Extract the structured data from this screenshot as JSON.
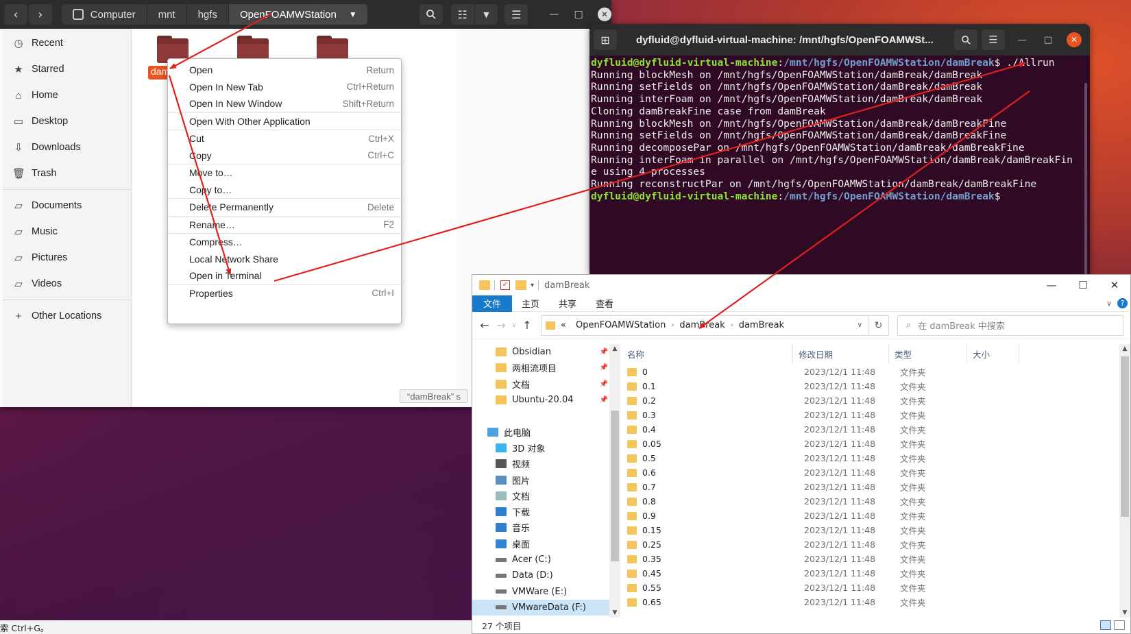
{
  "nautilus": {
    "path": [
      "Computer",
      "mnt",
      "hgfs",
      "OpenFOAMWStation"
    ],
    "sidebar": [
      {
        "label": "Recent",
        "icon": "clock-icon"
      },
      {
        "label": "Starred",
        "icon": "star-icon"
      },
      {
        "label": "Home",
        "icon": "home-icon"
      },
      {
        "label": "Desktop",
        "icon": "desktop-icon"
      },
      {
        "label": "Downloads",
        "icon": "download-icon"
      },
      {
        "label": "Trash",
        "icon": "trash-icon"
      },
      {
        "label": "Documents",
        "icon": "folder-icon"
      },
      {
        "label": "Music",
        "icon": "folder-icon"
      },
      {
        "label": "Pictures",
        "icon": "folder-icon"
      },
      {
        "label": "Videos",
        "icon": "folder-icon"
      },
      {
        "label": "Other Locations",
        "icon": "plus-icon"
      }
    ],
    "selected_folder_label": "dam",
    "status_text": "“damBreak” s",
    "accent_color": "#e95420"
  },
  "context_menu": {
    "items": [
      {
        "label": "Open",
        "shortcut": "Return"
      },
      {
        "label": "Open In New Tab",
        "shortcut": "Ctrl+Return"
      },
      {
        "label": "Open In New Window",
        "shortcut": "Shift+Return"
      },
      {
        "label": "Open With Other Application",
        "shortcut": ""
      },
      {
        "label": "Cut",
        "shortcut": "Ctrl+X"
      },
      {
        "label": "Copy",
        "shortcut": "Ctrl+C"
      },
      {
        "label": "Move to…",
        "shortcut": ""
      },
      {
        "label": "Copy to…",
        "shortcut": ""
      },
      {
        "label": "Delete Permanently",
        "shortcut": "Delete"
      },
      {
        "label": "Rename…",
        "shortcut": "F2"
      },
      {
        "label": "Compress…",
        "shortcut": ""
      },
      {
        "label": "Local Network Share",
        "shortcut": ""
      },
      {
        "label": "Open in Terminal",
        "shortcut": ""
      },
      {
        "label": "Properties",
        "shortcut": "Ctrl+I"
      }
    ]
  },
  "terminal": {
    "title": "dyfluid@dyfluid-virtual-machine: /mnt/hgfs/OpenFOAMWSt...",
    "prompt_user": "dyfluid@dyfluid-virtual-machine",
    "prompt_path": "/mnt/hgfs/OpenFOAMWStation/damBreak",
    "command": "./Allrun",
    "output": [
      "Running blockMesh on /mnt/hgfs/OpenFOAMWStation/damBreak/damBreak",
      "Running setFields on /mnt/hgfs/OpenFOAMWStation/damBreak/damBreak",
      "Running interFoam on /mnt/hgfs/OpenFOAMWStation/damBreak/damBreak",
      "Cloning damBreakFine case from damBreak",
      "Running blockMesh on /mnt/hgfs/OpenFOAMWStation/damBreak/damBreakFine",
      "Running setFields on /mnt/hgfs/OpenFOAMWStation/damBreak/damBreakFine",
      "Running decomposePar on /mnt/hgfs/OpenFOAMWStation/damBreak/damBreakFine",
      "Running interFoam in parallel on /mnt/hgfs/OpenFOAMWStation/damBreak/damBreakFin",
      "e using 4 processes",
      "Running reconstructPar on /mnt/hgfs/OpenFOAMWStation/damBreak/damBreakFine"
    ]
  },
  "explorer": {
    "title": "damBreak",
    "ribbon_tabs": [
      "文件",
      "主页",
      "共享",
      "查看"
    ],
    "address": {
      "prefix": "«",
      "segments": [
        "OpenFOAMWStation",
        "damBreak",
        "damBreak"
      ]
    },
    "search_placeholder": "在 damBreak 中搜索",
    "nav_items": [
      {
        "label": "Obsidian",
        "icon": "folder-icon",
        "pinned": true,
        "indent": 1
      },
      {
        "label": "两相流项目",
        "icon": "folder-icon",
        "pinned": true,
        "indent": 1
      },
      {
        "label": "文档",
        "icon": "folder-icon",
        "pinned": true,
        "indent": 1
      },
      {
        "label": "Ubuntu-20.04",
        "icon": "folder-icon",
        "pinned": true,
        "indent": 1
      },
      {
        "label": "",
        "icon": "",
        "pinned": false,
        "indent": 0
      },
      {
        "label": "此电脑",
        "icon": "computer-icon",
        "pinned": false,
        "indent": 0
      },
      {
        "label": "3D 对象",
        "icon": "cube-icon",
        "pinned": false,
        "indent": 1
      },
      {
        "label": "视频",
        "icon": "video-icon",
        "pinned": false,
        "indent": 1
      },
      {
        "label": "图片",
        "icon": "image-icon",
        "pinned": false,
        "indent": 1
      },
      {
        "label": "文档",
        "icon": "document-icon",
        "pinned": false,
        "indent": 1
      },
      {
        "label": "下载",
        "icon": "download-icon",
        "pinned": false,
        "indent": 1
      },
      {
        "label": "音乐",
        "icon": "music-icon",
        "pinned": false,
        "indent": 1
      },
      {
        "label": "桌面",
        "icon": "desktop-icon",
        "pinned": false,
        "indent": 1
      },
      {
        "label": "Acer (C:)",
        "icon": "drive-icon",
        "pinned": false,
        "indent": 1
      },
      {
        "label": "Data (D:)",
        "icon": "drive-icon",
        "pinned": false,
        "indent": 1
      },
      {
        "label": "VMWare (E:)",
        "icon": "drive-icon",
        "pinned": false,
        "indent": 1
      },
      {
        "label": "VMwareData (F:)",
        "icon": "drive-icon",
        "pinned": false,
        "indent": 1
      }
    ],
    "columns": [
      "名称",
      "修改日期",
      "类型",
      "大小"
    ],
    "files": [
      {
        "name": "0",
        "date": "2023/12/1 11:48",
        "type": "文件夹"
      },
      {
        "name": "0.1",
        "date": "2023/12/1 11:48",
        "type": "文件夹"
      },
      {
        "name": "0.2",
        "date": "2023/12/1 11:48",
        "type": "文件夹"
      },
      {
        "name": "0.3",
        "date": "2023/12/1 11:48",
        "type": "文件夹"
      },
      {
        "name": "0.4",
        "date": "2023/12/1 11:48",
        "type": "文件夹"
      },
      {
        "name": "0.05",
        "date": "2023/12/1 11:48",
        "type": "文件夹"
      },
      {
        "name": "0.5",
        "date": "2023/12/1 11:48",
        "type": "文件夹"
      },
      {
        "name": "0.6",
        "date": "2023/12/1 11:48",
        "type": "文件夹"
      },
      {
        "name": "0.7",
        "date": "2023/12/1 11:48",
        "type": "文件夹"
      },
      {
        "name": "0.8",
        "date": "2023/12/1 11:48",
        "type": "文件夹"
      },
      {
        "name": "0.9",
        "date": "2023/12/1 11:48",
        "type": "文件夹"
      },
      {
        "name": "0.15",
        "date": "2023/12/1 11:48",
        "type": "文件夹"
      },
      {
        "name": "0.25",
        "date": "2023/12/1 11:48",
        "type": "文件夹"
      },
      {
        "name": "0.35",
        "date": "2023/12/1 11:48",
        "type": "文件夹"
      },
      {
        "name": "0.45",
        "date": "2023/12/1 11:48",
        "type": "文件夹"
      },
      {
        "name": "0.55",
        "date": "2023/12/1 11:48",
        "type": "文件夹"
      },
      {
        "name": "0.65",
        "date": "2023/12/1 11:48",
        "type": "文件夹"
      }
    ],
    "status": "27 个项目",
    "accent_color": "#1979ca"
  },
  "bottom_hint": "索 Ctrl+G。",
  "annotation_color": "#e0201e"
}
